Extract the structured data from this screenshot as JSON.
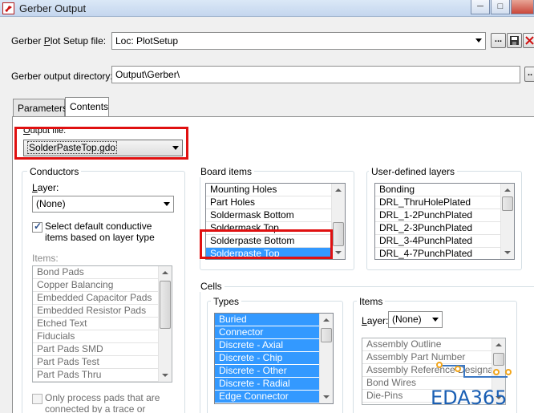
{
  "window": {
    "title": "Gerber Output",
    "minimize": "─",
    "maximize": "□"
  },
  "plot_setup": {
    "label_pre": "Gerber ",
    "label_u": "P",
    "label_post": "lot Setup file:",
    "value": "Loc: PlotSetup"
  },
  "output_dir": {
    "label": "Gerber output directory:",
    "value": "Output\\Gerber\\"
  },
  "tabs": [
    "Parameters",
    "Contents"
  ],
  "output_file": {
    "label_u": "O",
    "label_post": "utput file:",
    "value": "SolderPasteTop.gdo"
  },
  "conductors": {
    "title": "Conductors",
    "layer_label_u": "L",
    "layer_label_post": "ayer:",
    "layer_value": "(None)",
    "select_default": "Select default conductive items based on layer type",
    "items_label": "Items:",
    "items": [
      "Bond Pads",
      "Copper Balancing",
      "Embedded Capacitor Pads",
      "Embedded Resistor Pads",
      "Etched Text",
      "Fiducials",
      "Part Pads SMD",
      "Part Pads Test",
      "Part Pads Thru"
    ],
    "only_process": "Only process pads that are connected by a trace or plane"
  },
  "board_items": {
    "title": "Board items",
    "items": [
      "Mounting Holes",
      "Part Holes",
      "Soldermask Bottom",
      "Soldermask Top",
      "Solderpaste Bottom",
      "Solderpaste Top"
    ]
  },
  "user_layers": {
    "title": "User-defined layers",
    "items": [
      "Bonding",
      "DRL_ThruHolePlated",
      "DRL_1-2PunchPlated",
      "DRL_2-3PunchPlated",
      "DRL_3-4PunchPlated",
      "DRL_4-7PunchPlated"
    ]
  },
  "cells": {
    "title": "Cells",
    "types_title": "Types",
    "types": [
      "Buried",
      "Connector",
      "Discrete - Axial",
      "Discrete - Chip",
      "Discrete - Other",
      "Discrete - Radial",
      "Edge Connector"
    ],
    "items_title": "Items",
    "layer_label_u": "L",
    "layer_label_post": "ayer:",
    "layer_value": "(None)",
    "items": [
      "Assembly Outline",
      "Assembly Part Number",
      "Assembly Reference Designator",
      "Bond Wires",
      "Die-Pins"
    ]
  },
  "watermark": "EDA365"
}
